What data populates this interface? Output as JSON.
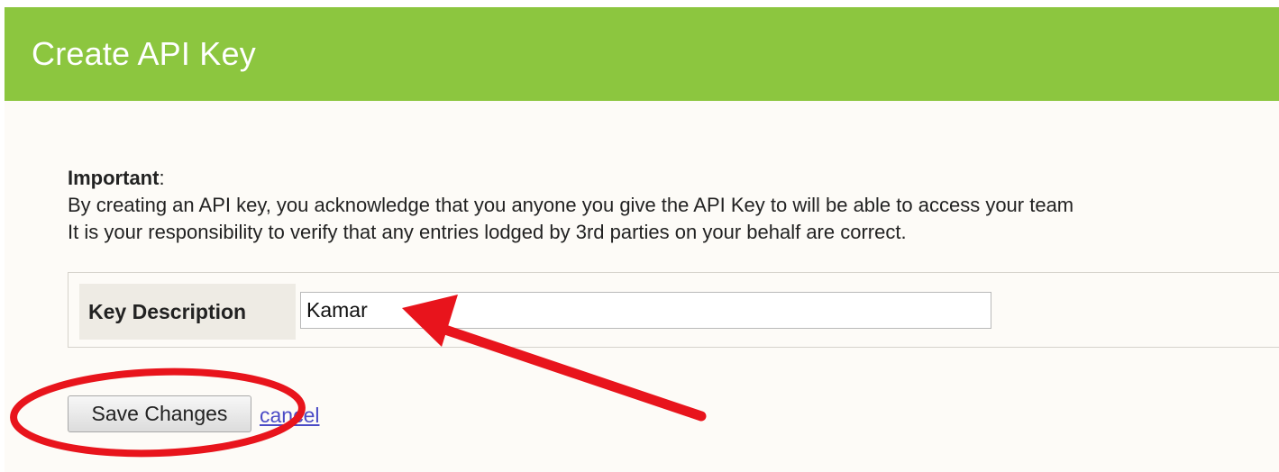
{
  "header": {
    "title": "Create API Key"
  },
  "notice": {
    "title": "Important",
    "title_suffix": ":",
    "line1": "By creating an API key, you acknowledge that you anyone you give the API Key to will be able to access your team",
    "line2": "It is your responsibility to verify that any entries lodged by 3rd parties on your behalf are correct."
  },
  "form": {
    "key_description_label": "Key Description",
    "key_description_value": "Kamar"
  },
  "actions": {
    "save_label": "Save Changes",
    "cancel_label": "cancel"
  },
  "colors": {
    "header": "#8cc63f",
    "panel": "#fdfbf7",
    "annotation": "#e8141c",
    "link": "#4b4bc6"
  }
}
